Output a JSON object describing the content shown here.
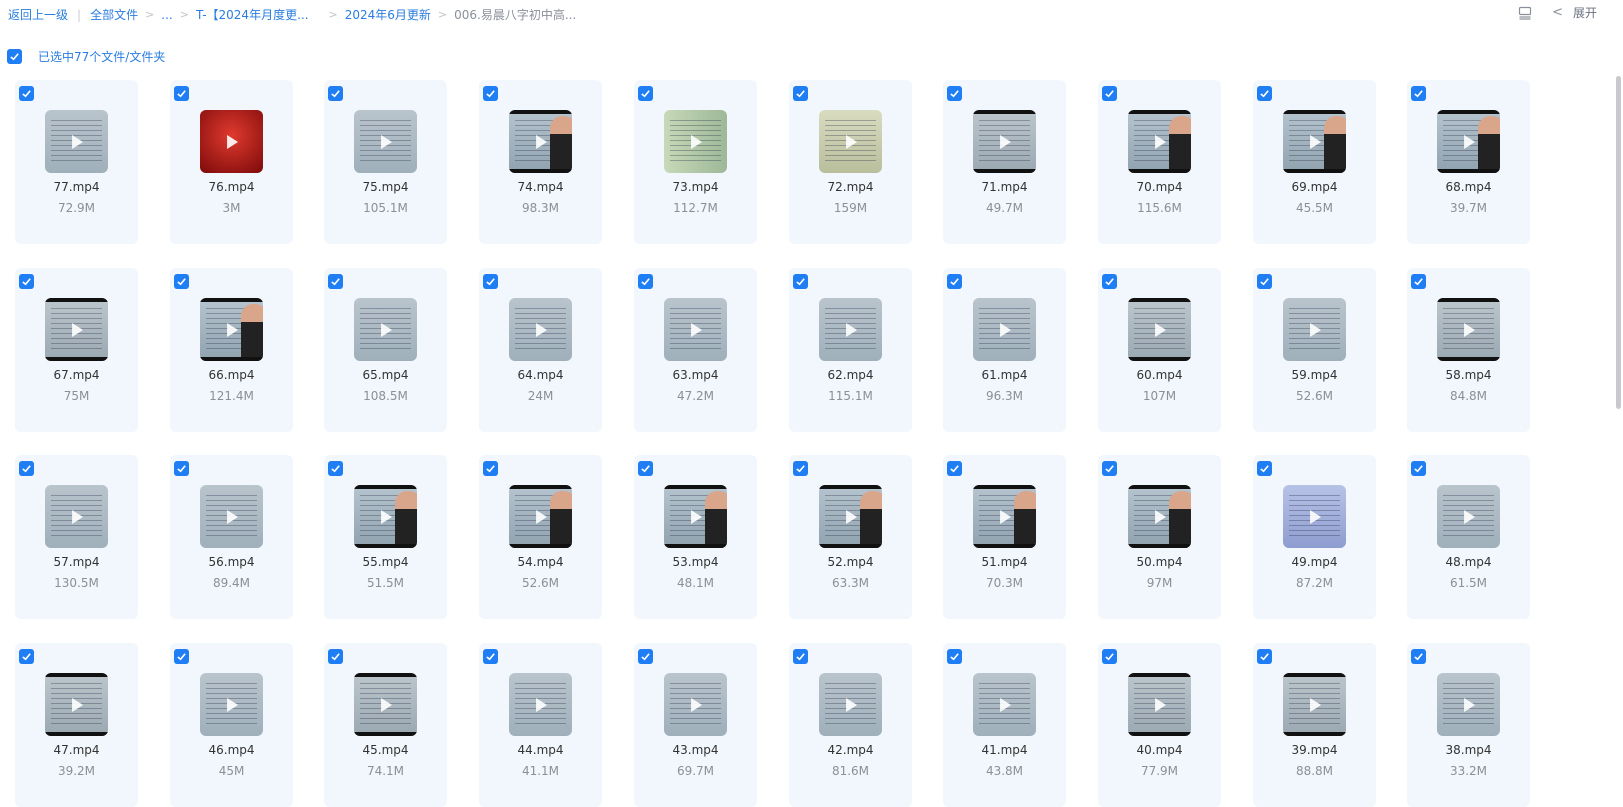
{
  "breadcrumb": {
    "back": "返回上一级",
    "all_files": "全部文件",
    "ellipsis": "...",
    "item1": "T-【2024年月度更...",
    "item2": "2024年6月更新",
    "current": "006.易晨八字初中高..."
  },
  "toolbar": {
    "expand_label": "展开"
  },
  "selection": {
    "label": "已选中77个文件/文件夹",
    "checked": true
  },
  "colors": {
    "accent": "#1f7ef3",
    "card_bg": "#f1f7fc"
  },
  "files": [
    {
      "name": "77.mp4",
      "size": "72.9M",
      "thumb": "slide"
    },
    {
      "name": "76.mp4",
      "size": "3M",
      "thumb": "red"
    },
    {
      "name": "75.mp4",
      "size": "105.1M",
      "thumb": "slide"
    },
    {
      "name": "74.mp4",
      "size": "98.3M",
      "thumb": "person"
    },
    {
      "name": "73.mp4",
      "size": "112.7M",
      "thumb": "green"
    },
    {
      "name": "72.mp4",
      "size": "159M",
      "thumb": "yellow"
    },
    {
      "name": "71.mp4",
      "size": "49.7M",
      "thumb": "bars"
    },
    {
      "name": "70.mp4",
      "size": "115.6M",
      "thumb": "person"
    },
    {
      "name": "69.mp4",
      "size": "45.5M",
      "thumb": "person"
    },
    {
      "name": "68.mp4",
      "size": "39.7M",
      "thumb": "person"
    },
    {
      "name": "67.mp4",
      "size": "75M",
      "thumb": "bars"
    },
    {
      "name": "66.mp4",
      "size": "121.4M",
      "thumb": "person"
    },
    {
      "name": "65.mp4",
      "size": "108.5M",
      "thumb": "slide"
    },
    {
      "name": "64.mp4",
      "size": "24M",
      "thumb": "slide"
    },
    {
      "name": "63.mp4",
      "size": "47.2M",
      "thumb": "slide"
    },
    {
      "name": "62.mp4",
      "size": "115.1M",
      "thumb": "slide"
    },
    {
      "name": "61.mp4",
      "size": "96.3M",
      "thumb": "slide"
    },
    {
      "name": "60.mp4",
      "size": "107M",
      "thumb": "bars"
    },
    {
      "name": "59.mp4",
      "size": "52.6M",
      "thumb": "slide"
    },
    {
      "name": "58.mp4",
      "size": "84.8M",
      "thumb": "bars"
    },
    {
      "name": "57.mp4",
      "size": "130.5M",
      "thumb": "slide"
    },
    {
      "name": "56.mp4",
      "size": "89.4M",
      "thumb": "slide"
    },
    {
      "name": "55.mp4",
      "size": "51.5M",
      "thumb": "person"
    },
    {
      "name": "54.mp4",
      "size": "52.6M",
      "thumb": "person"
    },
    {
      "name": "53.mp4",
      "size": "48.1M",
      "thumb": "person"
    },
    {
      "name": "52.mp4",
      "size": "63.3M",
      "thumb": "person"
    },
    {
      "name": "51.mp4",
      "size": "70.3M",
      "thumb": "person"
    },
    {
      "name": "50.mp4",
      "size": "97M",
      "thumb": "person"
    },
    {
      "name": "49.mp4",
      "size": "87.2M",
      "thumb": "purple"
    },
    {
      "name": "48.mp4",
      "size": "61.5M",
      "thumb": "slide"
    },
    {
      "name": "47.mp4",
      "size": "39.2M",
      "thumb": "bars"
    },
    {
      "name": "46.mp4",
      "size": "45M",
      "thumb": "slide"
    },
    {
      "name": "45.mp4",
      "size": "74.1M",
      "thumb": "bars"
    },
    {
      "name": "44.mp4",
      "size": "41.1M",
      "thumb": "slide"
    },
    {
      "name": "43.mp4",
      "size": "69.7M",
      "thumb": "slide"
    },
    {
      "name": "42.mp4",
      "size": "81.6M",
      "thumb": "slide"
    },
    {
      "name": "41.mp4",
      "size": "43.8M",
      "thumb": "slide"
    },
    {
      "name": "40.mp4",
      "size": "77.9M",
      "thumb": "bars"
    },
    {
      "name": "39.mp4",
      "size": "88.8M",
      "thumb": "bars"
    },
    {
      "name": "38.mp4",
      "size": "33.2M",
      "thumb": "slide"
    }
  ]
}
